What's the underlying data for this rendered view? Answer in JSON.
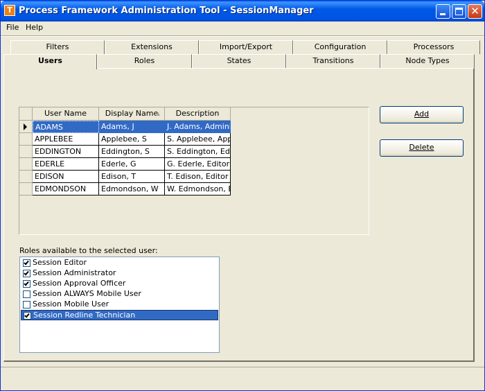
{
  "window": {
    "title": "Process Framework Administration Tool - SessionManager",
    "icon_letter": "T",
    "controls": [
      "minimize",
      "maximize",
      "close"
    ]
  },
  "menu": {
    "items": [
      "File",
      "Help"
    ]
  },
  "tabs": {
    "back_row": [
      "Filters",
      "Extensions",
      "Import/Export",
      "Configuration",
      "Processors"
    ],
    "front_row": [
      "Users",
      "Roles",
      "States",
      "Transitions",
      "Node Types"
    ],
    "active": "Users"
  },
  "users_grid": {
    "columns": [
      "User Name",
      "Display Name",
      "Description"
    ],
    "sorted_column": "Display Name",
    "selected_index": 0,
    "rows": [
      [
        "ADAMS",
        "Adams, J",
        "J. Adams, Administ"
      ],
      [
        "APPLEBEE",
        "Applebee, S",
        "S. Applebee, Appro"
      ],
      [
        "EDDINGTON",
        "Eddington, S",
        "S. Eddington, Edito"
      ],
      [
        "EDERLE",
        "Ederle, G",
        "G. Ederle, Editor"
      ],
      [
        "EDISON",
        "Edison, T",
        "T. Edison, Editor"
      ],
      [
        "EDMONDSON",
        "Edmondson, W",
        "W. Edmondson, Ed"
      ]
    ]
  },
  "buttons": {
    "add": "Add",
    "delete": "Delete"
  },
  "roles": {
    "label": "Roles available to the selected user:",
    "items": [
      {
        "label": "Session Editor",
        "checked": true
      },
      {
        "label": "Session Administrator",
        "checked": true
      },
      {
        "label": "Session Approval Officer",
        "checked": true
      },
      {
        "label": "Session ALWAYS Mobile User",
        "checked": false
      },
      {
        "label": "Session Mobile User",
        "checked": false
      },
      {
        "label": "Session Redline Technician",
        "checked": true,
        "selected": true
      }
    ]
  },
  "colors": {
    "selection": "#316ac5",
    "titlebar": "#0054e3",
    "face": "#ece9d8"
  }
}
